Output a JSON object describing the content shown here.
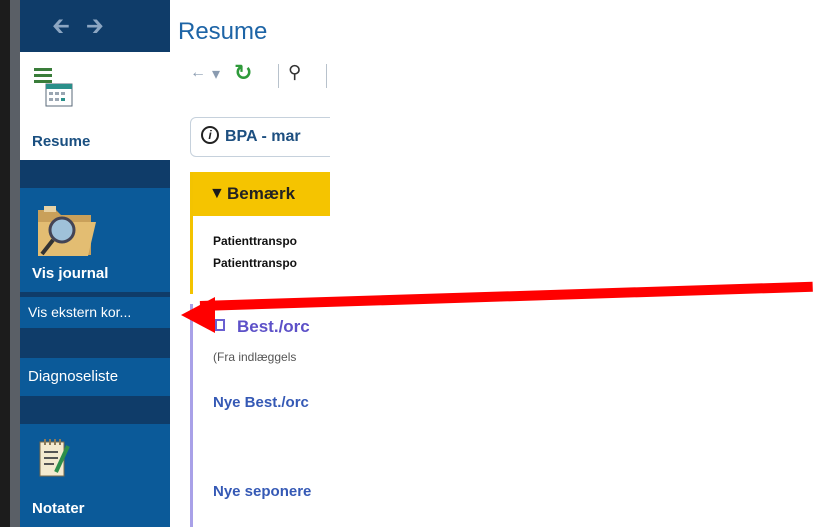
{
  "sidebar": {
    "resume_label": "Resume",
    "vis_journal_label": "Vis journal",
    "vis_ekstern_label": "Vis ekstern kor...",
    "diagnoseliste_label": "Diagnoseliste",
    "notater_label": "Notater"
  },
  "main": {
    "title": "Resume",
    "info_text": "BPA - mar",
    "warn_title": "Bemærk",
    "warn_lines": [
      "Patienttranspo",
      "Patienttranspo"
    ],
    "ord_title": "Best./orc",
    "ord_sub": "(Fra indlæggels",
    "ord_links": [
      "Nye Best./orc",
      "Nye seponere"
    ]
  },
  "colors": {
    "sidebar_bg": "#0f3c69",
    "item_bg": "#0b5a99",
    "warn": "#f5c400",
    "arrow": "#ff0000"
  }
}
